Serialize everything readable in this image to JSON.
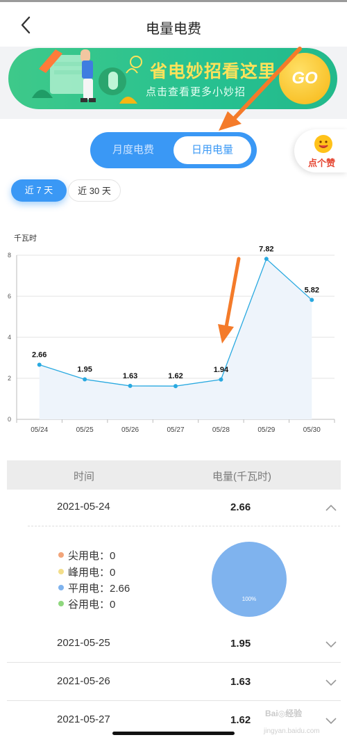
{
  "header": {
    "title": "电量电费"
  },
  "banner": {
    "headline": "省电妙招看这里",
    "subline": "点击查看更多小妙招",
    "go_label": "GO"
  },
  "view_toggle": {
    "options": [
      "月度电费",
      "日用电量"
    ],
    "selected": "日用电量"
  },
  "like_button": {
    "label": "点个赞"
  },
  "range_tabs": {
    "options": [
      "近 7 天",
      "近 30 天"
    ],
    "selected": "近 7 天"
  },
  "chart_data": {
    "type": "line",
    "ylabel": "千瓦时",
    "categories": [
      "05/24",
      "05/25",
      "05/26",
      "05/27",
      "05/28",
      "05/29",
      "05/30"
    ],
    "values": [
      2.66,
      1.95,
      1.63,
      1.62,
      1.94,
      7.82,
      5.82
    ],
    "value_labels": [
      "2.66",
      "1.95",
      "1.63",
      "1.62",
      "1.94",
      "7.82",
      "5.82"
    ],
    "ylim": [
      0,
      8
    ],
    "yticks": [
      "0",
      "2",
      "4",
      "6",
      "8"
    ],
    "grid": true,
    "line_color": "#29a9e0",
    "fill_color": "#eef4fb"
  },
  "table": {
    "headers": [
      "时间",
      "电量(千瓦时)"
    ],
    "rows": [
      {
        "date": "2021-05-24",
        "value": "2.66",
        "expanded": true
      },
      {
        "date": "2021-05-25",
        "value": "1.95"
      },
      {
        "date": "2021-05-26",
        "value": "1.63"
      },
      {
        "date": "2021-05-27",
        "value": "1.62"
      }
    ],
    "detail": {
      "items": [
        {
          "label": "尖用电：0",
          "color": "#f2a57a"
        },
        {
          "label": "峰用电：0",
          "color": "#f3de8a"
        },
        {
          "label": "平用电：2.66",
          "color": "#7fb3ee"
        },
        {
          "label": "谷用电：0",
          "color": "#8fd77e"
        }
      ],
      "pie_label": "100%"
    }
  },
  "watermark": {
    "line1": "Bai◎经验",
    "line2": "jingyan.baidu.com"
  }
}
